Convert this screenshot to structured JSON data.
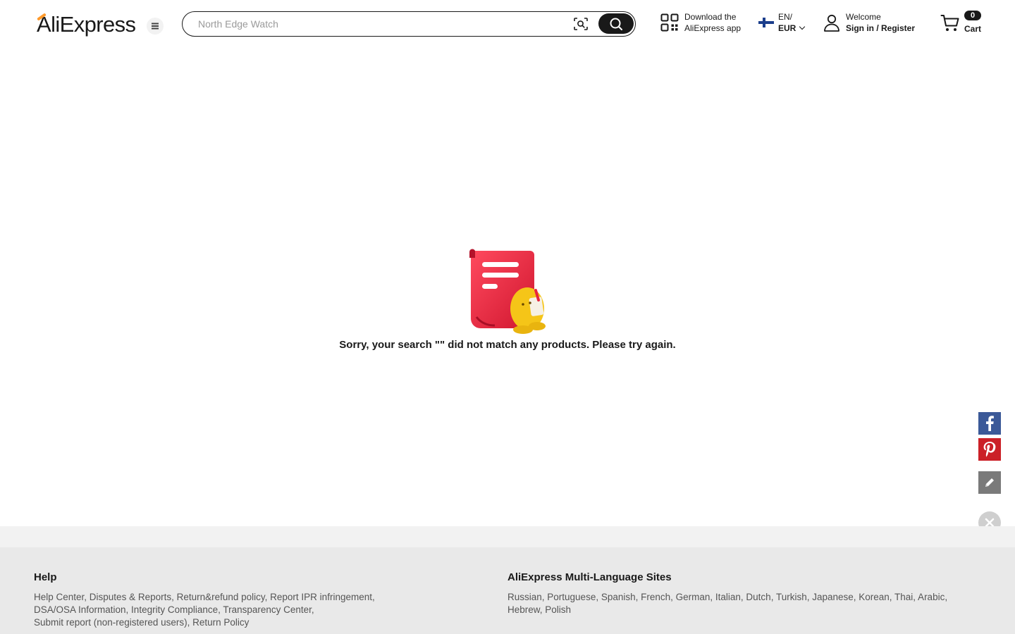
{
  "header": {
    "logo": "AliExpress",
    "search": {
      "placeholder": "North Edge Watch",
      "value": ""
    },
    "app_download": {
      "line1": "Download the",
      "line2": "AliExpress app"
    },
    "language": {
      "code": "EN/",
      "currency": "EUR"
    },
    "account": {
      "welcome": "Welcome",
      "sign_in": "Sign in / Register"
    },
    "cart": {
      "count": "0",
      "label": "Cart"
    }
  },
  "main": {
    "empty_message": "Sorry, your search \"\" did not match any products. Please try again."
  },
  "footer": {
    "help": {
      "title": "Help",
      "lines": [
        "Help Center, Disputes & Reports, Return&refund policy, Report IPR infringement,",
        "DSA/OSA Information, Integrity Compliance, Transparency Center,",
        "Submit report (non-registered users), Return Policy"
      ]
    },
    "languages": {
      "title": "AliExpress Multi-Language Sites",
      "lines": [
        "Russian, Portuguese, Spanish, French, German, Italian, Dutch, Turkish, Japanese, Korean, Thai, Arabic,",
        "Hebrew, Polish"
      ]
    }
  },
  "colors": {
    "text": "#191919",
    "facebook": "#3b5998",
    "pinterest": "#cb2027",
    "illustration_red": "#e8243d",
    "illustration_yellow": "#f5c518"
  },
  "icons": [
    "hamburger-icon",
    "camera-search-icon",
    "search-icon",
    "qr-code-icon",
    "finland-flag-icon",
    "chevron-down-icon",
    "user-icon",
    "cart-icon",
    "facebook-icon",
    "pinterest-icon",
    "pencil-icon",
    "close-icon"
  ]
}
